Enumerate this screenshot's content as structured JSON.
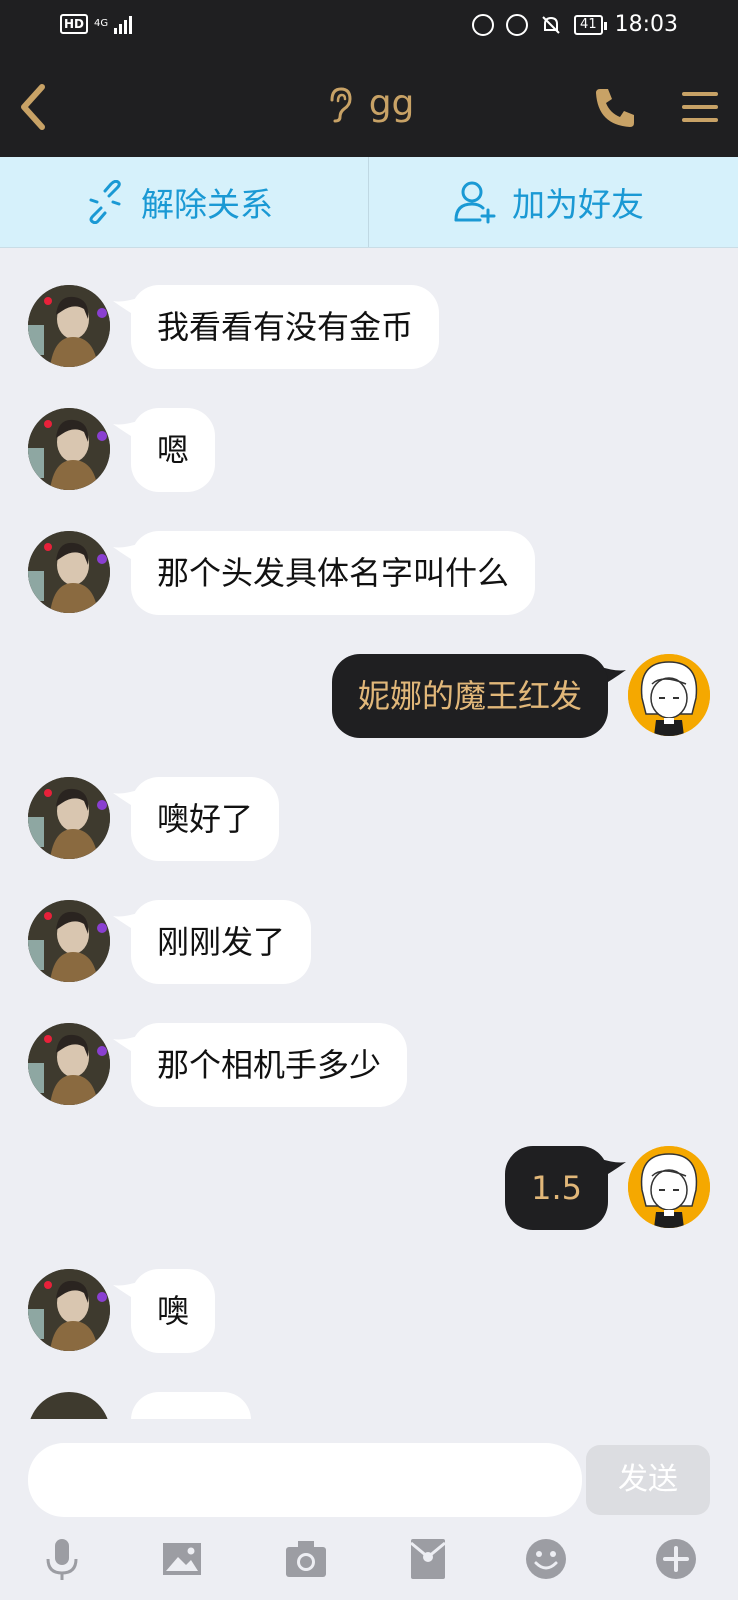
{
  "status": {
    "time": "18:03",
    "battery": "41",
    "hd": "HD",
    "net": "4G"
  },
  "header": {
    "title": "gg"
  },
  "actions": {
    "unlink_label": "解除关系",
    "add_friend_label": "加为好友"
  },
  "messages": [
    {
      "side": "in",
      "text": "我看看有没有金币"
    },
    {
      "side": "in",
      "text": "嗯"
    },
    {
      "side": "in",
      "text": "那个头发具体名字叫什么"
    },
    {
      "side": "out",
      "text": "妮娜的魔王红发"
    },
    {
      "side": "in",
      "text": "噢好了"
    },
    {
      "side": "in",
      "text": "刚刚发了"
    },
    {
      "side": "in",
      "text": "那个相机手多少"
    },
    {
      "side": "out",
      "text": "1.5"
    },
    {
      "side": "in",
      "text": "噢"
    }
  ],
  "input": {
    "value": "",
    "send_label": "发送"
  },
  "toolbar": [
    "microphone-icon",
    "image-icon",
    "camera-icon",
    "red-packet-icon",
    "emoji-icon",
    "plus-icon"
  ],
  "colors": {
    "header_bg": "#1F1F21",
    "accent_gold": "#C8A266",
    "link_blue": "#1A99D4",
    "action_bar_bg": "#D6F1FB",
    "chat_bg": "#EDEEF3"
  }
}
